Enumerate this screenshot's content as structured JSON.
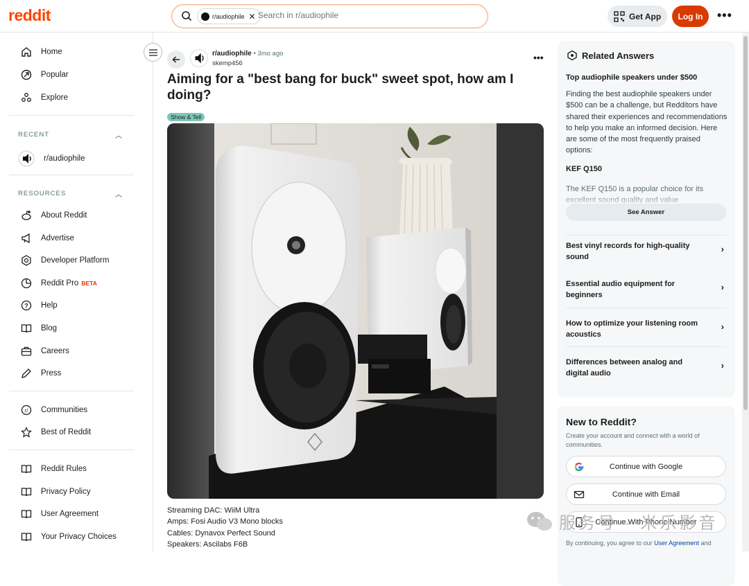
{
  "brand": {
    "logo": "reddit",
    "accent": "#ff4500",
    "login_color": "#d93a00"
  },
  "header": {
    "search_chip": "r/audiophile",
    "search_placeholder": "Search in r/audiophile",
    "get_app": "Get App",
    "login": "Log In",
    "more": "•••"
  },
  "sidebar": {
    "main": [
      {
        "label": "Home",
        "icon": "home-icon"
      },
      {
        "label": "Popular",
        "icon": "popular-icon"
      },
      {
        "label": "Explore",
        "icon": "explore-icon"
      }
    ],
    "recent_heading": "RECENT",
    "recent": [
      {
        "label": "r/audiophile",
        "icon": "subreddit-avatar"
      }
    ],
    "resources_heading": "RESOURCES",
    "resources": [
      {
        "label": "About Reddit",
        "icon": "reddit-icon"
      },
      {
        "label": "Advertise",
        "icon": "megaphone-icon"
      },
      {
        "label": "Developer Platform",
        "icon": "developer-icon"
      },
      {
        "label": "Reddit Pro",
        "icon": "pro-icon",
        "badge": "BETA"
      },
      {
        "label": "Help",
        "icon": "help-icon"
      },
      {
        "label": "Blog",
        "icon": "book-icon"
      },
      {
        "label": "Careers",
        "icon": "briefcase-icon"
      },
      {
        "label": "Press",
        "icon": "pen-icon"
      }
    ],
    "communities": [
      {
        "label": "Communities",
        "icon": "communities-icon"
      },
      {
        "label": "Best of Reddit",
        "icon": "best-icon"
      }
    ],
    "policies": [
      {
        "label": "Reddit Rules",
        "icon": "rules-icon"
      },
      {
        "label": "Privacy Policy",
        "icon": "privacy-icon"
      },
      {
        "label": "User Agreement",
        "icon": "agreement-icon"
      },
      {
        "label": "Your Privacy Choices",
        "icon": "choices-icon"
      }
    ]
  },
  "post": {
    "subreddit": "r/audiophile",
    "time": "• 3mo ago",
    "author": "skemp456",
    "title": "Aiming for a \"best bang for buck\" sweet spot, how am I doing?",
    "flair": "Show & Tell",
    "flair_color": "#7fc7b9",
    "body": [
      "Streaming DAC: WiiM Ultra",
      "Amps: Fosi Audio V3 Mono blocks",
      "Cables: Dynavox Perfect Sound",
      "Speakers: Ascilabs F6B"
    ]
  },
  "related": {
    "title": "Related Answers",
    "question": "Top audiophile speakers under $500",
    "answer": "Finding the best audiophile speakers under $500 can be a challenge, but Redditors have shared their experiences and recommendations to help you make an informed decision. Here are some of the most frequently praised options:",
    "pick": "KEF Q150",
    "pick_text": "The KEF Q150 is a popular choice for its excellent sound quality and value",
    "see_answer": "See Answer",
    "questions": [
      "Best vinyl records for high-quality sound",
      "Essential audio equipment for beginners",
      "How to optimize your listening room acoustics",
      "Differences between analog and digital audio"
    ]
  },
  "signup": {
    "title": "New to Reddit?",
    "subtitle": "Create your account and connect with a world of communities.",
    "google": "Continue with Google",
    "email": "Continue with Email",
    "phone": "Continue With Phone Number",
    "legal_prefix": "By continuing, you agree to our ",
    "legal_link": "User Agreement",
    "legal_suffix": " and"
  },
  "watermark": "服务号 · 米乐影音"
}
